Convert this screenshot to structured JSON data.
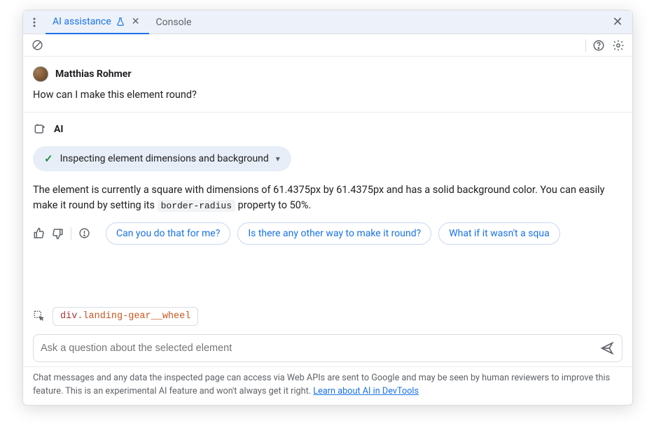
{
  "tabs": {
    "ai": "AI assistance",
    "console": "Console"
  },
  "user": {
    "name": "Matthias Rohmer",
    "question": "How can I make this element round?"
  },
  "ai": {
    "label": "AI",
    "inspect": "Inspecting element dimensions and background",
    "body_pre": "The element is currently a square with dimensions of 61.4375px by 61.4375px and has a solid background color. You can easily make it round by setting its ",
    "body_code": "border-radius",
    "body_post": " property to 50%."
  },
  "suggestions": [
    "Can you do that for me?",
    "Is there any other way to make it round?",
    "What if it wasn't a squa"
  ],
  "element": {
    "tag": "div",
    "cls": ".landing-gear__wheel"
  },
  "input": {
    "placeholder": "Ask a question about the selected element"
  },
  "footer": {
    "text": "Chat messages and any data the inspected page can access via Web APIs are sent to Google and may be seen by human reviewers to improve this feature. This is an experimental AI feature and won't always get it right. ",
    "link": "Learn about AI in DevTools"
  }
}
